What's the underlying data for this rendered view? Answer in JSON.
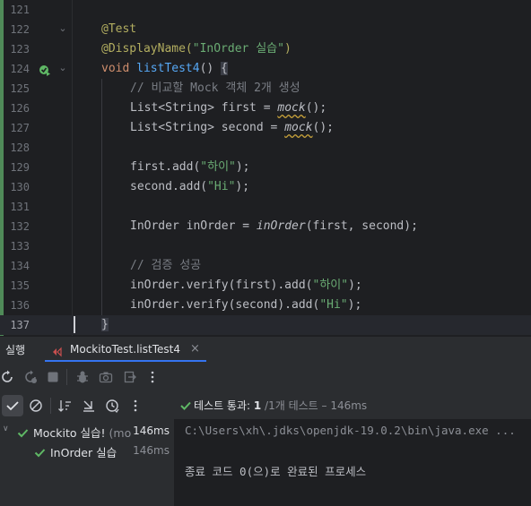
{
  "editor": {
    "lines": [
      {
        "num": "121"
      },
      {
        "num": "122"
      },
      {
        "num": "123"
      },
      {
        "num": "124"
      },
      {
        "num": "125"
      },
      {
        "num": "126"
      },
      {
        "num": "127"
      },
      {
        "num": "128"
      },
      {
        "num": "129"
      },
      {
        "num": "130"
      },
      {
        "num": "131"
      },
      {
        "num": "132"
      },
      {
        "num": "133"
      },
      {
        "num": "134"
      },
      {
        "num": "135"
      },
      {
        "num": "136"
      },
      {
        "num": "137"
      }
    ],
    "code": {
      "l122_annotation": "@Test",
      "l123_annotation": "@DisplayName(",
      "l123_string": "\"InOrder 실습\"",
      "l123_close": ")",
      "l124_kw": "void",
      "l124_fn": "listTest4",
      "l124_parens": "() ",
      "l124_brace": "{",
      "l125_comment": "// 비교할 Mock 객체 2개 생성",
      "l126_a": "List<String> first = ",
      "l126_mock": "mock",
      "l126_b": "();",
      "l127_a": "List<String> second = ",
      "l127_mock": "mock",
      "l127_b": "();",
      "l129_a": "first.add(",
      "l129_str": "\"하이\"",
      "l129_b": ");",
      "l130_a": "second.add(",
      "l130_str": "\"Hi\"",
      "l130_b": ");",
      "l132_a": "InOrder inOrder = ",
      "l132_static": "inOrder",
      "l132_b": "(first, second);",
      "l134_comment": "// 검증 성공",
      "l135_a": "inOrder.verify(first).add(",
      "l135_str": "\"하이\"",
      "l135_b": ");",
      "l136_a": "inOrder.verify(second).add(",
      "l136_str": "\"Hi\"",
      "l136_b": ");",
      "l137_brace": "}"
    }
  },
  "run_panel": {
    "title": "실행",
    "tab_label": "MockitoTest.listTest4",
    "tab_close": "×",
    "status": {
      "passed_label": "테스트 통과: ",
      "passed_count": "1",
      "total": " /1개 테스트 – 146ms"
    },
    "tree": [
      {
        "label": "Mockito 실습!",
        "sub": " (mo",
        "time": "146ms"
      },
      {
        "label": "InOrder 실습",
        "time": "146ms"
      }
    ],
    "console": {
      "line1": "C:\\Users\\xh\\.jdks\\openjdk-19.0.2\\bin\\java.exe ...",
      "line2": "종료 코드 0(으)로 완료된 프로세스"
    },
    "icons": {
      "toolbar": [
        "rerun-icon",
        "rerun-failed-icon",
        "stop-icon",
        "debug-icon",
        "camera-icon",
        "exit-icon",
        "more-icon"
      ],
      "test_toolbar": [
        "show-passed-icon",
        "show-ignored-icon",
        "sort-icon",
        "collapse-icon",
        "history-icon",
        "more-icon"
      ]
    },
    "colors": {
      "pass": "#5fb865",
      "accent": "#3574f0"
    }
  }
}
